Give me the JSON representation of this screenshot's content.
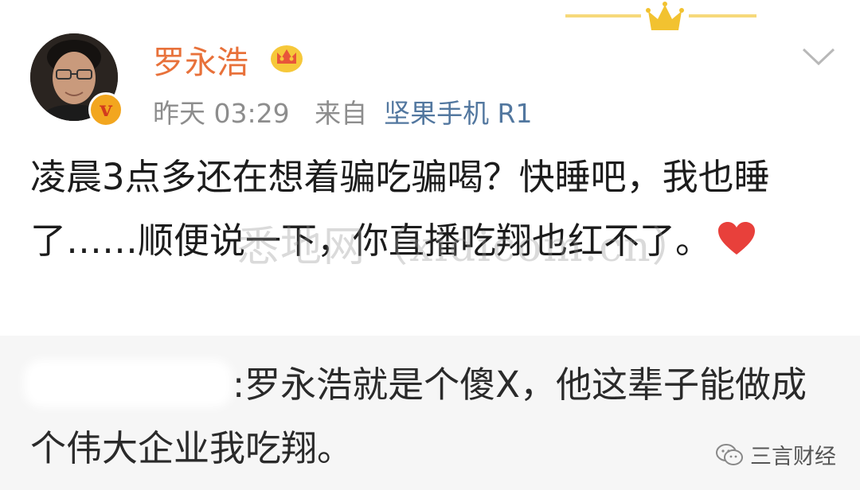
{
  "post": {
    "username": "罗永浩",
    "time": "昨天 03:29",
    "source_prefix": "来自",
    "source": "坚果手机 R1",
    "badge_letter": "v",
    "text": "凌晨3点多还在想着骗吃骗喝？快睡吧，我也睡了……顺便说一下，你直播吃翔也红不了。"
  },
  "watermark": "悉地网（xidicom.cn）",
  "quoted_comment": {
    "text": ":罗永浩就是个傻X，他这辈子能做成个伟大企业我吃翔。"
  },
  "footer": {
    "account": "三言财经"
  },
  "colors": {
    "username": "#e8713a",
    "source_link": "#52779f",
    "meta_gray": "#8d8d8d",
    "heart": "#e8403b",
    "crown": "#f2c230"
  },
  "icons": [
    "crown-icon",
    "vip-crown-icon",
    "verified-badge-icon",
    "chevron-down-icon",
    "heart-icon",
    "wechat-icon"
  ]
}
